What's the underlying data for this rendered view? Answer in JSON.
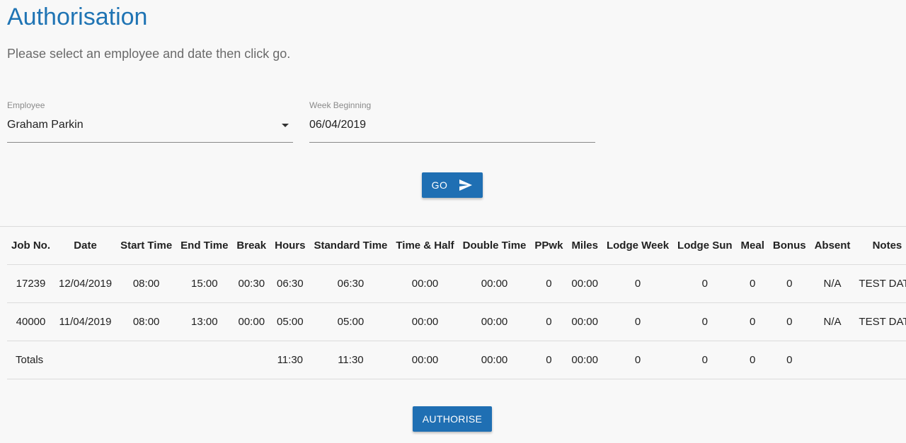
{
  "page": {
    "title": "Authorisation",
    "subtitle": "Please select an employee and date then click go."
  },
  "form": {
    "employee": {
      "label": "Employee",
      "value": "Graham Parkin",
      "icon": "chevron-down-icon"
    },
    "week_beginning": {
      "label": "Week Beginning",
      "value": "06/04/2019"
    },
    "go_label": "GO",
    "go_icon": "send-icon"
  },
  "table": {
    "headers": [
      "Job No.",
      "Date",
      "Start Time",
      "End Time",
      "Break",
      "Hours",
      "Standard Time",
      "Time & Half",
      "Double Time",
      "PPwk",
      "Miles",
      "Lodge Week",
      "Lodge Sun",
      "Meal",
      "Bonus",
      "Absent",
      "Notes"
    ],
    "rows": [
      [
        "17239",
        "12/04/2019",
        "08:00",
        "15:00",
        "00:30",
        "06:30",
        "06:30",
        "00:00",
        "00:00",
        "0",
        "00:00",
        "0",
        "0",
        "0",
        "0",
        "N/A",
        "TEST DATA"
      ],
      [
        "40000",
        "11/04/2019",
        "08:00",
        "13:00",
        "00:00",
        "05:00",
        "05:00",
        "00:00",
        "00:00",
        "0",
        "00:00",
        "0",
        "0",
        "0",
        "0",
        "N/A",
        "TEST DATA"
      ]
    ],
    "totals": [
      "Totals",
      "",
      "",
      "",
      "",
      "11:30",
      "11:30",
      "00:00",
      "00:00",
      "0",
      "00:00",
      "0",
      "0",
      "0",
      "0",
      "",
      ""
    ]
  },
  "actions": {
    "authorise_label": "AUTHORISE"
  },
  "colors": {
    "accent": "#1f74b4",
    "button": "#1f6fb3"
  }
}
